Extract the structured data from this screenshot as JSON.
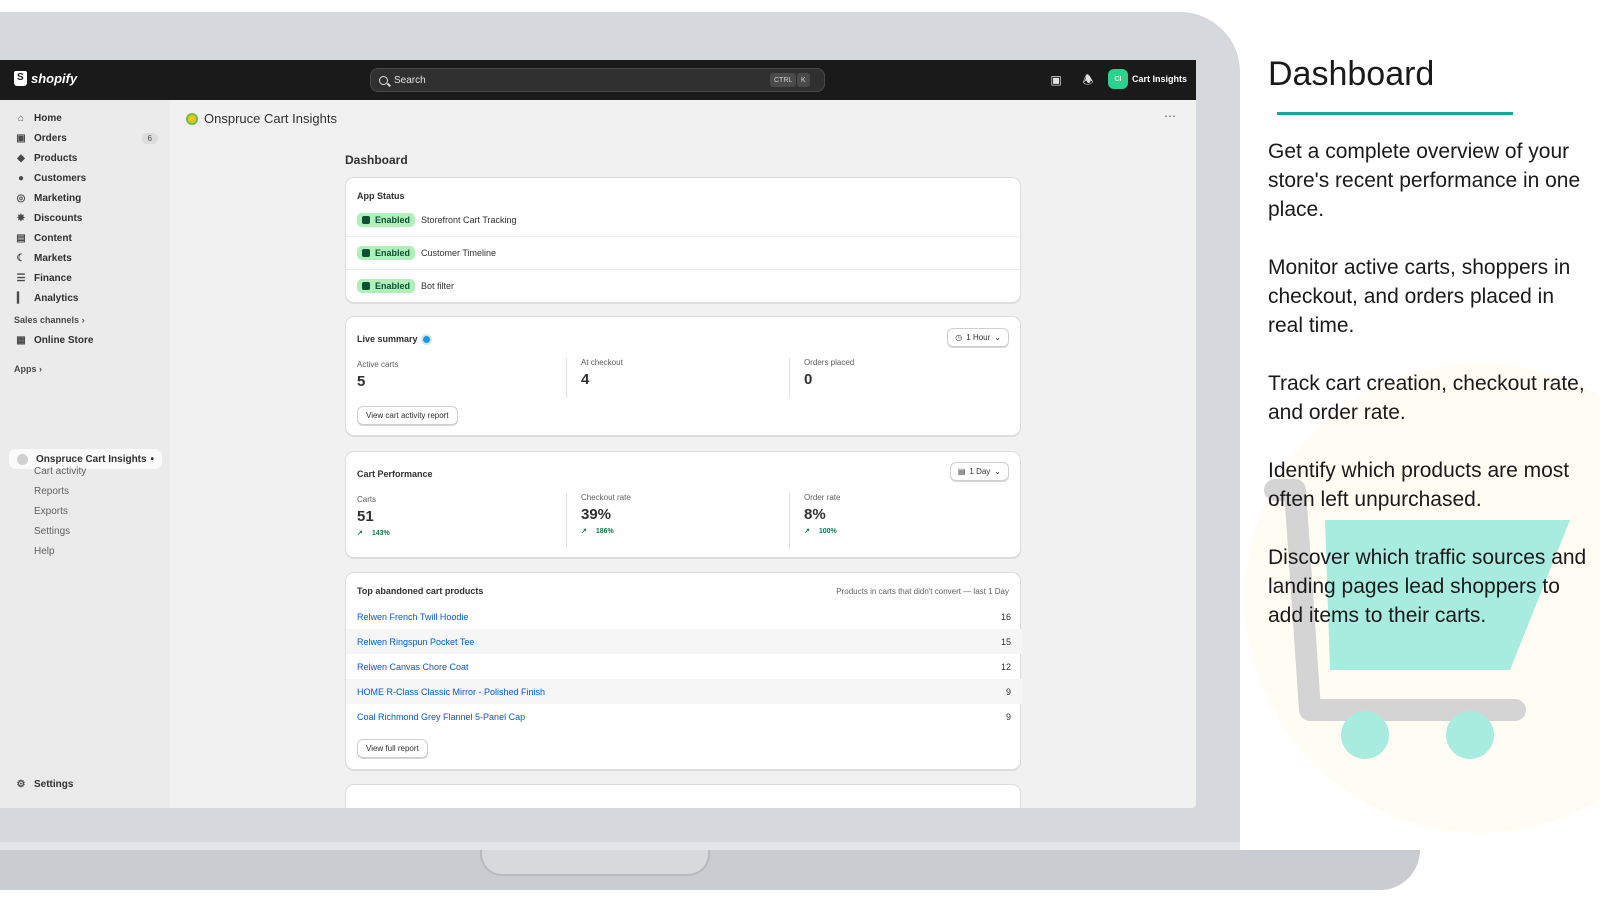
{
  "topbar": {
    "logo_text": "shopify",
    "search_placeholder": "Search",
    "shortcut_ctrl": "CTRL",
    "shortcut_key": "K",
    "store_initials": "CI",
    "store_name": "Cart Insights"
  },
  "sidebar": {
    "items": [
      {
        "label": "Home",
        "icon": "home-icon"
      },
      {
        "label": "Orders",
        "icon": "inbox-icon",
        "count": "6"
      },
      {
        "label": "Products",
        "icon": "tag-icon"
      },
      {
        "label": "Customers",
        "icon": "person-icon"
      },
      {
        "label": "Marketing",
        "icon": "target-icon"
      },
      {
        "label": "Discounts",
        "icon": "discount-icon"
      },
      {
        "label": "Content",
        "icon": "content-icon"
      },
      {
        "label": "Markets",
        "icon": "globe-icon"
      },
      {
        "label": "Finance",
        "icon": "bank-icon"
      },
      {
        "label": "Analytics",
        "icon": "bar-chart-icon"
      }
    ],
    "sales_channels_label": "Sales channels",
    "online_store_label": "Online Store",
    "apps_label": "Apps",
    "app_name": "Onspruce Cart Insights",
    "app_subitems": [
      "Cart activity",
      "Reports",
      "Exports",
      "Settings",
      "Help"
    ],
    "settings_label": "Settings"
  },
  "main": {
    "app_title": "Onspruce Cart Insights",
    "page_heading": "Dashboard",
    "app_status": {
      "title": "App Status",
      "rows": [
        {
          "badge": "Enabled",
          "label": "Storefront Cart Tracking"
        },
        {
          "badge": "Enabled",
          "label": "Customer Timeline"
        },
        {
          "badge": "Enabled",
          "label": "Bot filter"
        }
      ]
    },
    "live_summary": {
      "title": "Live summary",
      "range": "1 Hour",
      "metrics": [
        {
          "label": "Active carts",
          "value": "5"
        },
        {
          "label": "At checkout",
          "value": "4"
        },
        {
          "label": "Orders placed",
          "value": "0"
        }
      ],
      "button": "View cart activity report"
    },
    "cart_performance": {
      "title": "Cart Performance",
      "range": "1 Day",
      "metrics": [
        {
          "label": "Carts",
          "value": "51",
          "trend": "143%"
        },
        {
          "label": "Checkout rate",
          "value": "39%",
          "trend": "186%"
        },
        {
          "label": "Order rate",
          "value": "8%",
          "trend": "100%"
        }
      ]
    },
    "top_abandoned": {
      "title": "Top abandoned cart products",
      "subtitle": "Products in carts that didn't convert — last 1 Day",
      "products": [
        {
          "name": "Relwen French Twill Hoodie",
          "count": "16"
        },
        {
          "name": "Relwen Ringspun Pocket Tee",
          "count": "15"
        },
        {
          "name": "Relwen Canvas Chore Coat",
          "count": "12"
        },
        {
          "name": "HOME R-Class Classic Mirror - Polished Finish",
          "count": "9"
        },
        {
          "name": "Coal Richmond Grey Flannel 5-Panel Cap",
          "count": "9"
        }
      ],
      "button": "View full report"
    }
  },
  "panel": {
    "title": "Dashboard",
    "paragraphs": [
      "Get a complete overview of your store's recent performance in one place.",
      "Monitor active carts, shoppers in checkout, and orders placed in real time.",
      "Track cart creation, checkout rate, and order rate.",
      "Identify which products are most often left unpurchased.",
      "Discover which traffic sources and landing pages lead shoppers to add items to their carts."
    ],
    "accent_color": "#1aa597",
    "cart_color": "#a8ece0"
  }
}
